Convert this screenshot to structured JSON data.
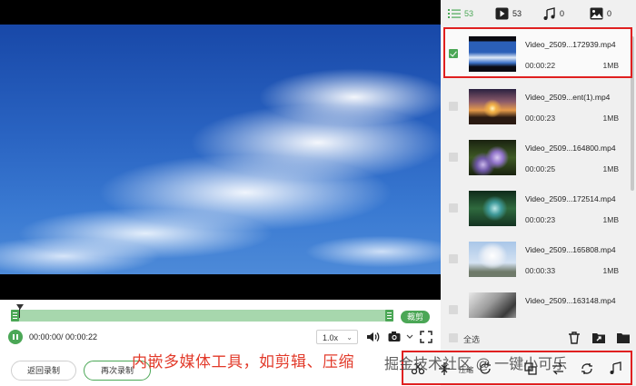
{
  "tabs": [
    {
      "icon": "list-icon",
      "count": "53"
    },
    {
      "icon": "video-play-icon",
      "count": "53"
    },
    {
      "icon": "music-note-icon",
      "count": "0"
    },
    {
      "icon": "image-icon",
      "count": "0"
    }
  ],
  "files": [
    {
      "name": "Video_2509...172939.mp4",
      "duration": "00:00:22",
      "size": "1MB",
      "checked": true
    },
    {
      "name": "Video_2509...ent(1).mp4",
      "duration": "00:00:23",
      "size": "1MB",
      "checked": false
    },
    {
      "name": "Video_2509...164800.mp4",
      "duration": "00:00:25",
      "size": "1MB",
      "checked": false
    },
    {
      "name": "Video_2509...172514.mp4",
      "duration": "00:00:23",
      "size": "1MB",
      "checked": false
    },
    {
      "name": "Video_2509...165808.mp4",
      "duration": "00:00:33",
      "size": "1MB",
      "checked": false
    },
    {
      "name": "Video_2509...163148.mp4",
      "duration": "",
      "size": "",
      "checked": false
    }
  ],
  "panel": {
    "select_all": "全选"
  },
  "timeline": {
    "crop_label": "裁剪"
  },
  "playback": {
    "time": "00:00:00/ 00:00:22",
    "speed": "1.0x"
  },
  "buttons": {
    "back": "返回录制",
    "record_again": "再次录制"
  },
  "toolbar": {
    "compress_label": "压缩"
  },
  "caption": "内嵌多媒体工具，如剪辑、压缩",
  "watermark": "掘金技术社区 @ 一键小可乐",
  "colors": {
    "accent": "#4ba756",
    "highlight": "#e02020",
    "caption": "#e23a2a"
  }
}
